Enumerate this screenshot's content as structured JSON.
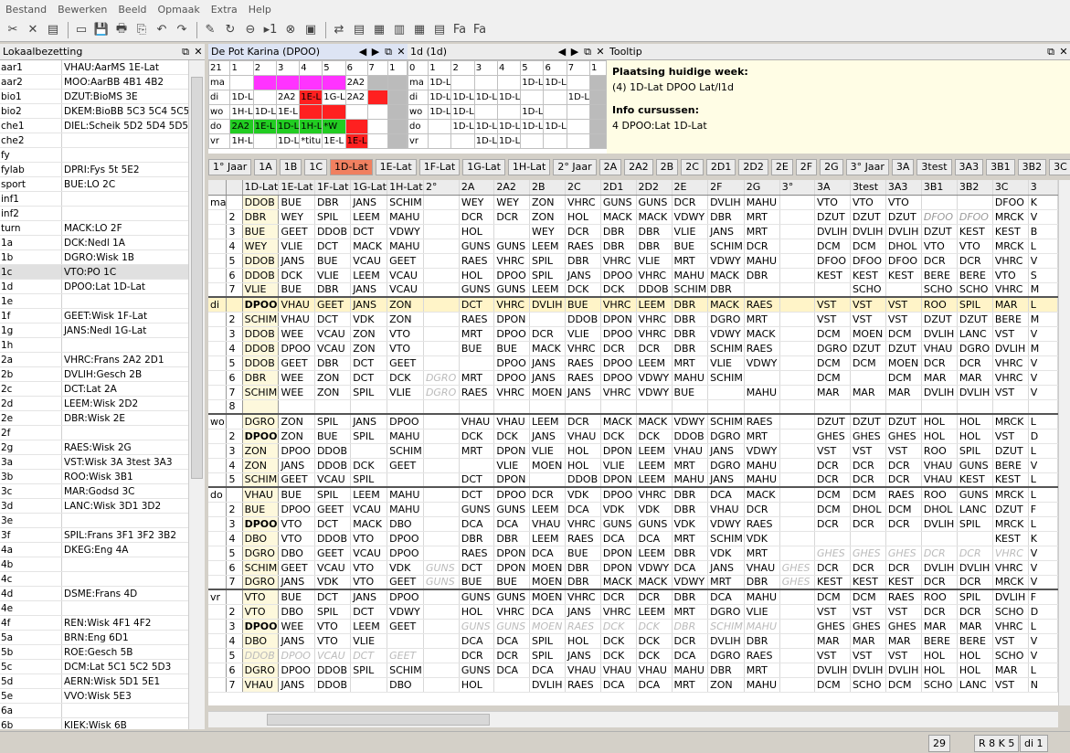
{
  "menu": [
    "Bestand",
    "Bewerken",
    "Beeld",
    "Opmaak",
    "Extra",
    "Help"
  ],
  "toolbar": [
    "✂",
    "✕",
    "▤",
    "▭",
    "💾",
    "🖶",
    "⎘",
    "↶",
    "↷",
    "✎",
    "↻",
    "⊖",
    "▸1",
    "⊗",
    "▣",
    "⇄",
    "▤",
    "▦",
    "▥",
    "▦",
    "▤",
    "Fa",
    "Fa"
  ],
  "left": {
    "title": "Lokaalbezetting",
    "rows": [
      [
        "aar1",
        "VHAU:AarMS 1E-Lat"
      ],
      [
        "aar2",
        "MOO:AarBB 4B1 4B2"
      ],
      [
        "bio1",
        "DZUT:BioMS 3E"
      ],
      [
        "bio2",
        "DKEM:BioBB 5C3 5C4 5C5"
      ],
      [
        "che1",
        "DIEL:Scheik 5D2 5D4 5D5"
      ],
      [
        "che2",
        ""
      ],
      [
        "fy",
        ""
      ],
      [
        "fylab",
        "DPRI:Fys 5t 5E2"
      ],
      [
        "sport",
        "BUE:LO 2C"
      ],
      [
        "inf1",
        ""
      ],
      [
        "inf2",
        ""
      ],
      [
        "turn",
        "MACK:LO 2F"
      ],
      [
        "1a",
        "DCK:Nedl 1A"
      ],
      [
        "1b",
        "DGRO:Wisk 1B"
      ],
      [
        "1c",
        "VTO:PO 1C"
      ],
      [
        "1d",
        "DPOO:Lat 1D-Lat"
      ],
      [
        "1e",
        ""
      ],
      [
        "1f",
        "GEET:Wisk 1F-Lat"
      ],
      [
        "1g",
        "JANS:Nedl 1G-Lat"
      ],
      [
        "1h",
        ""
      ],
      [
        "2a",
        "VHRC:Frans 2A2 2D1"
      ],
      [
        "2b",
        "DVLIH:Gesch 2B"
      ],
      [
        "2c",
        "DCT:Lat 2A"
      ],
      [
        "2d",
        "LEEM:Wisk 2D2"
      ],
      [
        "2e",
        "DBR:Wisk 2E"
      ],
      [
        "2f",
        ""
      ],
      [
        "2g",
        "RAES:Wisk 2G"
      ],
      [
        "3a",
        "VST:Wisk 3A 3test 3A3"
      ],
      [
        "3b",
        "ROO:Wisk 3B1"
      ],
      [
        "3c",
        "MAR:Godsd 3C"
      ],
      [
        "3d",
        "LANC:Wisk 3D1 3D2"
      ],
      [
        "3e",
        ""
      ],
      [
        "3f",
        "SPIL:Frans 3F1 3F2 3B2"
      ],
      [
        "4a",
        "DKEG:Eng 4A"
      ],
      [
        "4b",
        ""
      ],
      [
        "4c",
        ""
      ],
      [
        "4d",
        "DSME:Frans 4D"
      ],
      [
        "4e",
        ""
      ],
      [
        "4f",
        "REN:Wisk 4F1 4F2"
      ],
      [
        "5a",
        "BRN:Eng 6D1"
      ],
      [
        "5b",
        "ROE:Gesch 5B"
      ],
      [
        "5c",
        "DCM:Lat 5C1 5C2 5D3"
      ],
      [
        "5d",
        "AERN:Wisk 5D1 5E1"
      ],
      [
        "5e",
        "VVO:Wisk 5E3"
      ],
      [
        "6a",
        ""
      ],
      [
        "6b",
        "KIEK:Wisk 6B"
      ]
    ]
  },
  "p1": {
    "title": "De Pot Karina (DPOO)",
    "header": [
      "21",
      "1",
      "2",
      "3",
      "4",
      "5",
      "6",
      "7",
      "1"
    ],
    "rows": [
      [
        "ma",
        "",
        "",
        "",
        "",
        "",
        "2A2",
        "",
        ""
      ],
      [
        "di",
        "1D-L",
        "",
        "2A2",
        "1E-L",
        "1G-L",
        "2A2",
        "",
        ""
      ],
      [
        "wo",
        "1H-L",
        "1D-L",
        "1E-L",
        "",
        "",
        "",
        "",
        ""
      ],
      [
        "do",
        "2A2",
        "1E-L",
        "1D-L",
        "1H-L",
        "*W",
        "",
        "",
        ""
      ],
      [
        "vr",
        "1H-L",
        "",
        "1D-L",
        "*titu",
        "1E-L",
        "1E-L",
        "",
        ""
      ]
    ],
    "colors": [
      [
        "",
        "#ff33ff",
        "#ff33ff",
        "#ff33ff",
        "#ff33ff",
        "",
        "#bbb",
        ""
      ],
      [
        "",
        "",
        "",
        "#ff2020",
        "",
        "",
        "#ff2020",
        ""
      ],
      [
        "",
        "",
        "",
        "#ff2020",
        "#ff2020",
        "",
        "",
        ""
      ],
      [
        "#22cc22",
        "#22cc22",
        "#22cc22",
        "#22cc22",
        "#22cc22",
        "#ff2020",
        "",
        ""
      ],
      [
        "",
        "",
        "",
        "",
        "",
        "#ff2020",
        "",
        ""
      ]
    ]
  },
  "p2": {
    "title": "1d (1d)",
    "header": [
      "0",
      "1",
      "2",
      "3",
      "4",
      "5",
      "6",
      "7",
      "1"
    ],
    "rows": [
      [
        "ma",
        "1D-L",
        "",
        "",
        "",
        "1D-L",
        "1D-L",
        "",
        ""
      ],
      [
        "di",
        "1D-L",
        "1D-L",
        "1D-L",
        "1D-L",
        "",
        "",
        "1D-L",
        ""
      ],
      [
        "wo",
        "1D-L",
        "1D-L",
        "",
        "",
        "1D-L",
        "",
        "",
        ""
      ],
      [
        "do",
        "",
        "1D-L",
        "1D-L",
        "1D-L",
        "1D-L",
        "1D-L",
        "",
        ""
      ],
      [
        "vr",
        "",
        "",
        "1D-L",
        "1D-L",
        "",
        "",
        "",
        ""
      ]
    ]
  },
  "tooltip": {
    "title": "Tooltip",
    "h1": "Plaatsing huidige week:",
    "l1": "(4) 1D-Lat DPOO Lat/l1d",
    "h2": "Info cursussen:",
    "l2": "4 DPOO:Lat 1D-Lat"
  },
  "tabs": [
    "1° Jaar",
    "1A",
    "1B",
    "1C",
    "1D-Lat",
    "1E-Lat",
    "1F-Lat",
    "1G-Lat",
    "1H-Lat",
    "2° Jaar",
    "2A",
    "2A2",
    "2B",
    "2C",
    "2D1",
    "2D2",
    "2E",
    "2F",
    "2G",
    "3° Jaar",
    "3A",
    "3test",
    "3A3",
    "3B1",
    "3B2",
    "3C"
  ],
  "active_tab": "1D-Lat",
  "grid": {
    "cols": [
      "1D-Lat",
      "1E-Lat",
      "1F-Lat",
      "1G-Lat",
      "1H-Lat",
      "2°",
      "2A",
      "2A2",
      "2B",
      "2C",
      "2D1",
      "2D2",
      "2E",
      "2F",
      "2G",
      "3°",
      "3A",
      "3test",
      "3A3",
      "3B1",
      "3B2",
      "3C",
      "3"
    ],
    "rows": [
      [
        "ma",
        "",
        "DDOB",
        "BUE",
        "DBR",
        "JANS",
        "SCHIM",
        "",
        "WEY",
        "WEY",
        "ZON",
        "VHRC",
        "GUNS",
        "GUNS",
        "DCR",
        "DVLIH",
        "MAHU",
        "",
        "VTO",
        "VTO",
        "VTO",
        "",
        "",
        "DFOO",
        "K"
      ],
      [
        "",
        "2",
        "DBR",
        "WEY",
        "SPIL",
        "LEEM",
        "MAHU",
        "",
        "DCR",
        "DCR",
        "ZON",
        "HOL",
        "MACK",
        "MACK",
        "VDWY",
        "DBR",
        "MRT",
        "",
        "DZUT",
        "DZUT",
        "DZUT",
        "DFOO",
        "DFOO",
        "MRCK",
        "V"
      ],
      [
        "",
        "3",
        "BUE",
        "GEET",
        "DDOB",
        "DCT",
        "VDWY",
        "",
        "HOL",
        "",
        "WEY",
        "DCR",
        "DBR",
        "DBR",
        "VLIE",
        "JANS",
        "MRT",
        "",
        "DVLIH",
        "DVLIH",
        "DVLIH",
        "DZUT",
        "KEST",
        "KEST",
        "B"
      ],
      [
        "",
        "4",
        "WEY",
        "VLIE",
        "DCT",
        "MACK",
        "MAHU",
        "",
        "GUNS",
        "GUNS",
        "LEEM",
        "RAES",
        "DBR",
        "DBR",
        "BUE",
        "SCHIM",
        "DCR",
        "",
        "DCM",
        "DCM",
        "DHOL",
        "VTO",
        "VTO",
        "MRCK",
        "L"
      ],
      [
        "",
        "5",
        "DDOB",
        "JANS",
        "BUE",
        "VCAU",
        "GEET",
        "",
        "RAES",
        "VHRC",
        "SPIL",
        "DBR",
        "VHRC",
        "VLIE",
        "MRT",
        "VDWY",
        "MAHU",
        "",
        "DFOO",
        "DFOO",
        "DFOO",
        "DCR",
        "DCR",
        "VHRC",
        "V"
      ],
      [
        "",
        "6",
        "DDOB",
        "DCK",
        "VLIE",
        "LEEM",
        "VCAU",
        "",
        "HOL",
        "DPOO",
        "SPIL",
        "JANS",
        "DPOO",
        "VHRC",
        "MAHU",
        "MACK",
        "DBR",
        "",
        "KEST",
        "KEST",
        "KEST",
        "BERE",
        "BERE",
        "VTO",
        "S"
      ],
      [
        "",
        "7",
        "VLIE",
        "BUE",
        "DBR",
        "JANS",
        "VCAU",
        "",
        "GUNS",
        "GUNS",
        "LEEM",
        "DCK",
        "DCK",
        "DDOB",
        "SCHIM",
        "DBR",
        "",
        "",
        "",
        "SCHO",
        "",
        "SCHO",
        "SCHO",
        "VHRC",
        "M"
      ],
      [
        "di",
        "",
        "DPOO",
        "VHAU",
        "GEET",
        "JANS",
        "ZON",
        "",
        "DCT",
        "VHRC",
        "DVLIH",
        "BUE",
        "VHRC",
        "LEEM",
        "DBR",
        "MACK",
        "RAES",
        "",
        "VST",
        "VST",
        "VST",
        "ROO",
        "SPIL",
        "MAR",
        "L"
      ],
      [
        "",
        "2",
        "SCHIM",
        "VHAU",
        "DCT",
        "VDK",
        "ZON",
        "",
        "RAES",
        "DPON",
        "",
        "DDOB",
        "DPON",
        "VHRC",
        "DBR",
        "DGRO",
        "MRT",
        "",
        "VST",
        "VST",
        "VST",
        "DZUT",
        "DZUT",
        "BERE",
        "M"
      ],
      [
        "",
        "3",
        "DDOB",
        "WEE",
        "VCAU",
        "ZON",
        "VTO",
        "",
        "MRT",
        "DPOO",
        "DCR",
        "VLIE",
        "DPOO",
        "VHRC",
        "DBR",
        "VDWY",
        "MACK",
        "",
        "DCM",
        "MOEN",
        "DCM",
        "DVLIH",
        "LANC",
        "VST",
        "V"
      ],
      [
        "",
        "4",
        "DDOB",
        "DPOO",
        "VCAU",
        "ZON",
        "VTO",
        "",
        "BUE",
        "BUE",
        "MACK",
        "VHRC",
        "DCR",
        "DCR",
        "DBR",
        "SCHIM",
        "RAES",
        "",
        "DGRO",
        "DZUT",
        "DZUT",
        "VHAU",
        "DGRO",
        "DVLIH",
        "M"
      ],
      [
        "",
        "5",
        "DDOB",
        "GEET",
        "DBR",
        "DCT",
        "GEET",
        "",
        "",
        "DPOO",
        "JANS",
        "RAES",
        "DPOO",
        "LEEM",
        "MRT",
        "VLIE",
        "VDWY",
        "",
        "DCM",
        "DCM",
        "MOEN",
        "DCR",
        "DCR",
        "VHRC",
        "V"
      ],
      [
        "",
        "6",
        "DBR",
        "WEE",
        "ZON",
        "DCT",
        "DCK",
        "DGRO",
        "MRT",
        "DPOO",
        "JANS",
        "RAES",
        "DPOO",
        "VDWY",
        "MAHU",
        "SCHIM",
        "",
        "",
        "DCM",
        "",
        "DCM",
        "MAR",
        "MAR",
        "VHRC",
        "V"
      ],
      [
        "",
        "7",
        "SCHIM",
        "WEE",
        "ZON",
        "SPIL",
        "VLIE",
        "DGRO",
        "RAES",
        "VHRC",
        "MOEN",
        "JANS",
        "VHRC",
        "VDWY",
        "BUE",
        "",
        "MAHU",
        "",
        "MAR",
        "MAR",
        "MAR",
        "DVLIH",
        "DVLIH",
        "VST",
        "V"
      ],
      [
        "",
        "8",
        "",
        "",
        "",
        "",
        "",
        "",
        "",
        "",
        "",
        "",
        "",
        "",
        "",
        "",
        "",
        "",
        "",
        "",
        "",
        "",
        "",
        "",
        ""
      ],
      [
        "wo",
        "",
        "DGRO",
        "ZON",
        "SPIL",
        "JANS",
        "DPOO",
        "",
        "VHAU",
        "VHAU",
        "LEEM",
        "DCR",
        "MACK",
        "MACK",
        "VDWY",
        "SCHIM",
        "RAES",
        "",
        "DZUT",
        "DZUT",
        "DZUT",
        "HOL",
        "HOL",
        "MRCK",
        "L"
      ],
      [
        "",
        "2",
        "DPOO",
        "ZON",
        "BUE",
        "SPIL",
        "MAHU",
        "",
        "DCK",
        "DCK",
        "JANS",
        "VHAU",
        "DCK",
        "DCK",
        "DDOB",
        "DGRO",
        "MRT",
        "",
        "GHES",
        "GHES",
        "GHES",
        "HOL",
        "HOL",
        "VST",
        "D"
      ],
      [
        "",
        "3",
        "ZON",
        "DPOO",
        "DDOB",
        "",
        "SCHIM",
        "",
        "MRT",
        "DPON",
        "VLIE",
        "HOL",
        "DPON",
        "LEEM",
        "VHAU",
        "JANS",
        "VDWY",
        "",
        "VST",
        "VST",
        "VST",
        "ROO",
        "SPIL",
        "DZUT",
        "L"
      ],
      [
        "",
        "4",
        "ZON",
        "JANS",
        "DDOB",
        "DCK",
        "GEET",
        "",
        "",
        "VLIE",
        "MOEN",
        "HOL",
        "VLIE",
        "LEEM",
        "MRT",
        "DGRO",
        "MAHU",
        "",
        "DCR",
        "DCR",
        "DCR",
        "VHAU",
        "GUNS",
        "BERE",
        "V"
      ],
      [
        "",
        "5",
        "SCHIM",
        "GEET",
        "VCAU",
        "SPIL",
        "",
        "",
        "DCT",
        "DPON",
        "",
        "DDOB",
        "DPON",
        "LEEM",
        "MAHU",
        "JANS",
        "MAHU",
        "",
        "DCR",
        "DCR",
        "DCR",
        "VHAU",
        "KEST",
        "KEST",
        "L"
      ],
      [
        "do",
        "",
        "VHAU",
        "BUE",
        "SPIL",
        "LEEM",
        "MAHU",
        "",
        "DCT",
        "DPOO",
        "DCR",
        "VDK",
        "DPOO",
        "VHRC",
        "DBR",
        "DCA",
        "MACK",
        "",
        "DCM",
        "DCM",
        "RAES",
        "ROO",
        "GUNS",
        "MRCK",
        "L"
      ],
      [
        "",
        "2",
        "BUE",
        "DPOO",
        "GEET",
        "VCAU",
        "MAHU",
        "",
        "GUNS",
        "GUNS",
        "LEEM",
        "DCA",
        "VDK",
        "VDK",
        "DBR",
        "VHAU",
        "DCR",
        "",
        "DCM",
        "DHOL",
        "DCM",
        "DHOL",
        "LANC",
        "DZUT",
        "F"
      ],
      [
        "",
        "3",
        "DPOO",
        "VTO",
        "DCT",
        "MACK",
        "DBO",
        "",
        "DCA",
        "DCA",
        "VHAU",
        "VHRC",
        "GUNS",
        "GUNS",
        "VDK",
        "VDWY",
        "RAES",
        "",
        "DCR",
        "DCR",
        "DCR",
        "DVLIH",
        "SPIL",
        "MRCK",
        "L"
      ],
      [
        "",
        "4",
        "DBO",
        "VTO",
        "DDOB",
        "VTO",
        "DPOO",
        "",
        "DBR",
        "DBR",
        "LEEM",
        "RAES",
        "DCA",
        "DCA",
        "MRT",
        "SCHIM",
        "VDK",
        "",
        "",
        "",
        "",
        "",
        "",
        "KEST",
        "K"
      ],
      [
        "",
        "5",
        "DGRO",
        "DBO",
        "GEET",
        "VCAU",
        "DPOO",
        "",
        "RAES",
        "DPON",
        "DCA",
        "BUE",
        "DPON",
        "LEEM",
        "DBR",
        "VDK",
        "MRT",
        "",
        "GHES",
        "GHES",
        "GHES",
        "DCR",
        "DCR",
        "VHRC",
        "V"
      ],
      [
        "",
        "6",
        "SCHIM",
        "GEET",
        "VCAU",
        "VTO",
        "VDK",
        "GUNS",
        "DCT",
        "DPON",
        "MOEN",
        "DBR",
        "DPON",
        "VDWY",
        "DCA",
        "JANS",
        "VHAU",
        "GHES",
        "DCR",
        "DCR",
        "DCR",
        "DVLIH",
        "DVLIH",
        "VHRC",
        "V"
      ],
      [
        "",
        "7",
        "DGRO",
        "JANS",
        "VDK",
        "VTO",
        "GEET",
        "GUNS",
        "BUE",
        "BUE",
        "MOEN",
        "DBR",
        "MACK",
        "MACK",
        "VDWY",
        "MRT",
        "DBR",
        "GHES",
        "KEST",
        "KEST",
        "KEST",
        "DCR",
        "DCR",
        "MRCK",
        "V"
      ],
      [
        "vr",
        "",
        "VTO",
        "BUE",
        "DCT",
        "JANS",
        "DPOO",
        "",
        "GUNS",
        "GUNS",
        "MOEN",
        "VHRC",
        "DCR",
        "DCR",
        "DBR",
        "DCA",
        "MAHU",
        "",
        "DCM",
        "DCM",
        "RAES",
        "ROO",
        "SPIL",
        "DVLIH",
        "F"
      ],
      [
        "",
        "2",
        "VTO",
        "DBO",
        "SPIL",
        "DCT",
        "VDWY",
        "",
        "HOL",
        "VHRC",
        "DCA",
        "JANS",
        "VHRC",
        "LEEM",
        "MRT",
        "DGRO",
        "VLIE",
        "",
        "VST",
        "VST",
        "VST",
        "DCR",
        "DCR",
        "SCHO",
        "D"
      ],
      [
        "",
        "3",
        "DPOO",
        "WEE",
        "VTO",
        "LEEM",
        "GEET",
        "",
        "GUNS",
        "GUNS",
        "MOEN",
        "RAES",
        "DCK",
        "DCK",
        "DBR",
        "SCHIM",
        "MAHU",
        "",
        "GHES",
        "GHES",
        "GHES",
        "MAR",
        "MAR",
        "VHRC",
        "L"
      ],
      [
        "",
        "4",
        "DBO",
        "JANS",
        "VTO",
        "VLIE",
        "",
        "",
        "DCA",
        "DCA",
        "SPIL",
        "HOL",
        "DCK",
        "DCK",
        "DCR",
        "DVLIH",
        "DBR",
        "",
        "MAR",
        "MAR",
        "MAR",
        "BERE",
        "BERE",
        "VST",
        "V"
      ],
      [
        "",
        "5",
        "DDOB",
        "DPOO",
        "VCAU",
        "DCT",
        "GEET",
        "",
        "DCR",
        "DCR",
        "SPIL",
        "JANS",
        "DCK",
        "DCK",
        "DCA",
        "DGRO",
        "RAES",
        "",
        "VST",
        "VST",
        "VST",
        "HOL",
        "HOL",
        "SCHO",
        "V"
      ],
      [
        "",
        "6",
        "DGRO",
        "DPOO",
        "DDOB",
        "SPIL",
        "SCHIM",
        "",
        "GUNS",
        "DCA",
        "DCA",
        "VHAU",
        "VHAU",
        "VHAU",
        "MAHU",
        "DBR",
        "MRT",
        "",
        "DVLIH",
        "DVLIH",
        "DVLIH",
        "HOL",
        "HOL",
        "MAR",
        "L"
      ],
      [
        "",
        "7",
        "VHAU",
        "JANS",
        "DDOB",
        "",
        "DBO",
        "",
        "HOL",
        "",
        "DVLIH",
        "RAES",
        "DCA",
        "DCA",
        "MRT",
        "ZON",
        "MAHU",
        "",
        "DCM",
        "SCHO",
        "DCM",
        "SCHO",
        "LANC",
        "VST",
        "N"
      ]
    ]
  },
  "status": {
    "s1": "29",
    "s2": "R 8 K 5",
    "s3": "di 1"
  }
}
